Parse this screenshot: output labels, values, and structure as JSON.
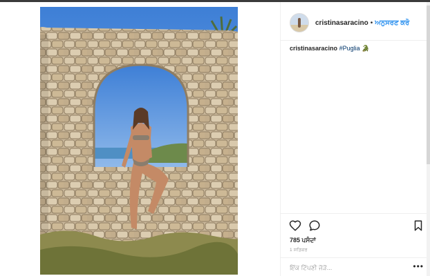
{
  "post": {
    "username": "cristinasaracino",
    "separator": "•",
    "follow_label": "ਅਨੁਸਰਣ ਕਰੋ",
    "photo_icon": "post-photo",
    "caption": {
      "username": "cristinasaracino",
      "hashtag": "#Puglia",
      "emoji": "🐊"
    },
    "likes_text": "785 ਪਸੰਦਾਂ",
    "timestamp": "1 ਸਤਿਕਰ",
    "comment_placeholder": "ਇੱਕ ਟਿੱਪਣੀ ਜੋੜੋ...",
    "more_label": "•••"
  },
  "icons": {
    "like": "heart-icon",
    "comment": "comment-bubble-icon",
    "save": "bookmark-icon",
    "more": "more-options-icon"
  },
  "colors": {
    "link_blue": "#3897f0",
    "hashtag": "#003569",
    "text": "#262626",
    "muted": "#999999",
    "border": "#efefef"
  }
}
